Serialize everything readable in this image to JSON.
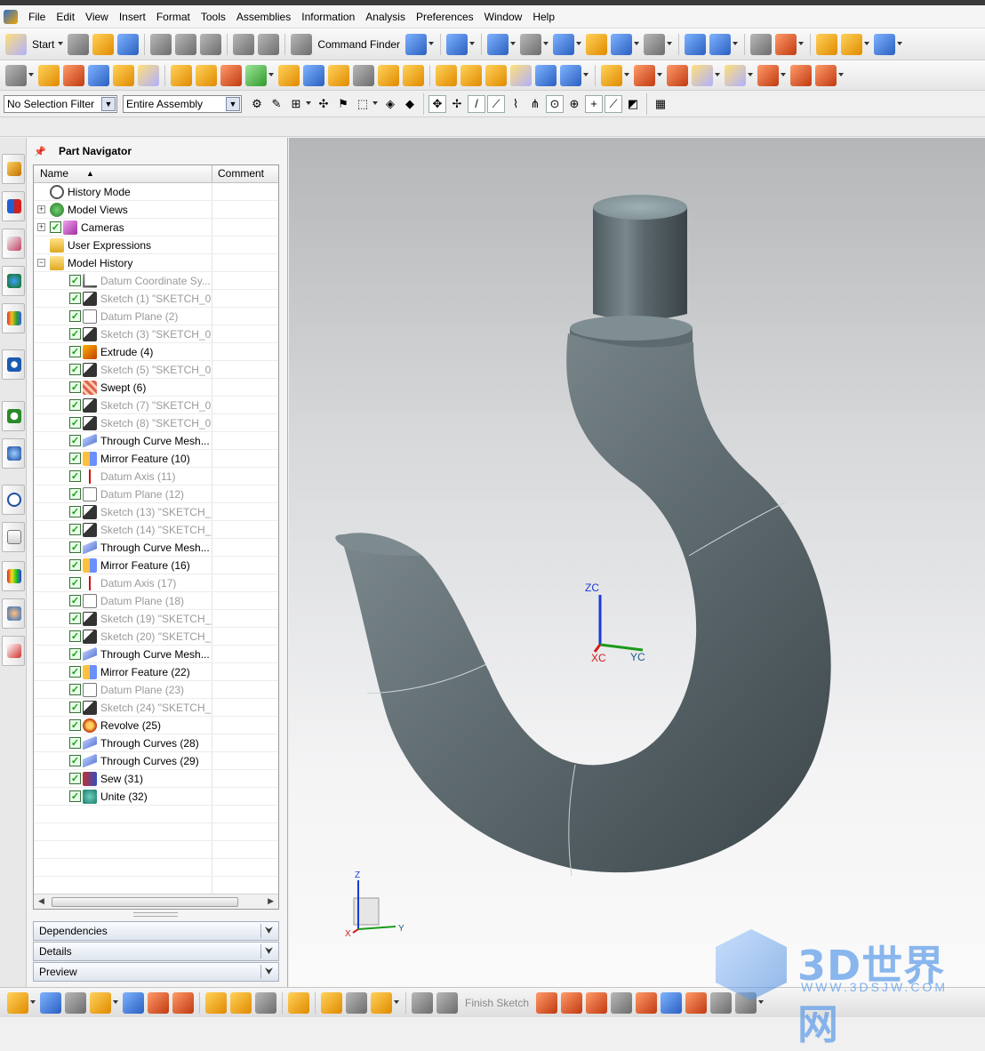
{
  "menu": [
    "File",
    "Edit",
    "View",
    "Insert",
    "Format",
    "Tools",
    "Assemblies",
    "Information",
    "Analysis",
    "Preferences",
    "Window",
    "Help"
  ],
  "toolbar1": {
    "start_label": "Start",
    "command_finder_label": "Command Finder"
  },
  "selection": {
    "filter": "No Selection Filter",
    "scope": "Entire Assembly"
  },
  "navigator": {
    "title": "Part Navigator",
    "col_name": "Name",
    "col_comment": "Comment",
    "items": [
      {
        "label": "History Mode",
        "icon": "clock-icon",
        "indent": 1,
        "check": false,
        "expander": "",
        "dim": false
      },
      {
        "label": "Model Views",
        "icon": "views-icon",
        "indent": 1,
        "check": false,
        "expander": "+",
        "dim": false
      },
      {
        "label": "Cameras",
        "icon": "camera-icon",
        "indent": 1,
        "check": true,
        "expander": "+",
        "dim": false
      },
      {
        "label": "User Expressions",
        "icon": "folder-icon",
        "indent": 1,
        "check": false,
        "expander": "",
        "dim": false
      },
      {
        "label": "Model History",
        "icon": "folder-icon",
        "indent": 1,
        "check": false,
        "expander": "−",
        "dim": false
      },
      {
        "label": "Datum Coordinate Sy...",
        "icon": "datum-csys-icon",
        "indent": 2,
        "check": true,
        "dim": true
      },
      {
        "label": "Sketch (1) \"SKETCH_0...",
        "icon": "sketch-icon",
        "indent": 2,
        "check": true,
        "dim": true
      },
      {
        "label": "Datum Plane (2)",
        "icon": "datum-plane-icon",
        "indent": 2,
        "check": true,
        "dim": true
      },
      {
        "label": "Sketch (3) \"SKETCH_0...",
        "icon": "sketch-icon",
        "indent": 2,
        "check": true,
        "dim": true
      },
      {
        "label": "Extrude (4)",
        "icon": "extrude-icon",
        "indent": 2,
        "check": true,
        "dim": false
      },
      {
        "label": "Sketch (5) \"SKETCH_0...",
        "icon": "sketch-icon",
        "indent": 2,
        "check": true,
        "dim": true
      },
      {
        "label": "Swept (6)",
        "icon": "swept-icon",
        "indent": 2,
        "check": true,
        "dim": false
      },
      {
        "label": "Sketch (7) \"SKETCH_0...",
        "icon": "sketch-icon",
        "indent": 2,
        "check": true,
        "dim": true
      },
      {
        "label": "Sketch (8) \"SKETCH_0...",
        "icon": "sketch-icon",
        "indent": 2,
        "check": true,
        "dim": true
      },
      {
        "label": "Through Curve Mesh...",
        "icon": "mesh-icon",
        "indent": 2,
        "check": true,
        "dim": false
      },
      {
        "label": "Mirror Feature (10)",
        "icon": "mirror-icon",
        "indent": 2,
        "check": true,
        "dim": false
      },
      {
        "label": "Datum Axis (11)",
        "icon": "datum-axis-icon",
        "indent": 2,
        "check": true,
        "dim": true
      },
      {
        "label": "Datum Plane (12)",
        "icon": "datum-plane-icon",
        "indent": 2,
        "check": true,
        "dim": true
      },
      {
        "label": "Sketch (13) \"SKETCH_...",
        "icon": "sketch-icon",
        "indent": 2,
        "check": true,
        "dim": true
      },
      {
        "label": "Sketch (14) \"SKETCH_...",
        "icon": "sketch-icon",
        "indent": 2,
        "check": true,
        "dim": true
      },
      {
        "label": "Through Curve Mesh...",
        "icon": "mesh-icon",
        "indent": 2,
        "check": true,
        "dim": false
      },
      {
        "label": "Mirror Feature (16)",
        "icon": "mirror-icon",
        "indent": 2,
        "check": true,
        "dim": false
      },
      {
        "label": "Datum Axis (17)",
        "icon": "datum-axis-icon",
        "indent": 2,
        "check": true,
        "dim": true
      },
      {
        "label": "Datum Plane (18)",
        "icon": "datum-plane-icon",
        "indent": 2,
        "check": true,
        "dim": true
      },
      {
        "label": "Sketch (19) \"SKETCH_...",
        "icon": "sketch-icon",
        "indent": 2,
        "check": true,
        "dim": true
      },
      {
        "label": "Sketch (20) \"SKETCH_...",
        "icon": "sketch-icon",
        "indent": 2,
        "check": true,
        "dim": true
      },
      {
        "label": "Through Curve Mesh...",
        "icon": "mesh-icon",
        "indent": 2,
        "check": true,
        "dim": false
      },
      {
        "label": "Mirror Feature (22)",
        "icon": "mirror-icon",
        "indent": 2,
        "check": true,
        "dim": false
      },
      {
        "label": "Datum Plane (23)",
        "icon": "datum-plane-icon",
        "indent": 2,
        "check": true,
        "dim": true
      },
      {
        "label": "Sketch (24) \"SKETCH_...",
        "icon": "sketch-icon",
        "indent": 2,
        "check": true,
        "dim": true
      },
      {
        "label": "Revolve (25)",
        "icon": "revolve-icon",
        "indent": 2,
        "check": true,
        "dim": false
      },
      {
        "label": "Through Curves (28)",
        "icon": "mesh-icon",
        "indent": 2,
        "check": true,
        "dim": false
      },
      {
        "label": "Through Curves (29)",
        "icon": "mesh-icon",
        "indent": 2,
        "check": true,
        "dim": false
      },
      {
        "label": "Sew (31)",
        "icon": "sew-icon",
        "indent": 2,
        "check": true,
        "dim": false
      },
      {
        "label": "Unite (32)",
        "icon": "unite-icon",
        "indent": 2,
        "check": true,
        "dim": false
      }
    ],
    "sections": [
      "Dependencies",
      "Details",
      "Preview"
    ]
  },
  "viewport": {
    "triad_center": {
      "z": "ZC",
      "x": "XC",
      "y": "YC"
    },
    "triad_corner": {
      "z": "Z",
      "x": "X",
      "y": "Y"
    },
    "model": "hook-model"
  },
  "bottom": {
    "finish_sketch": "Finish Sketch"
  },
  "watermark": {
    "brand": "3D世界网",
    "url": "WWW.3DSJW.COM"
  }
}
